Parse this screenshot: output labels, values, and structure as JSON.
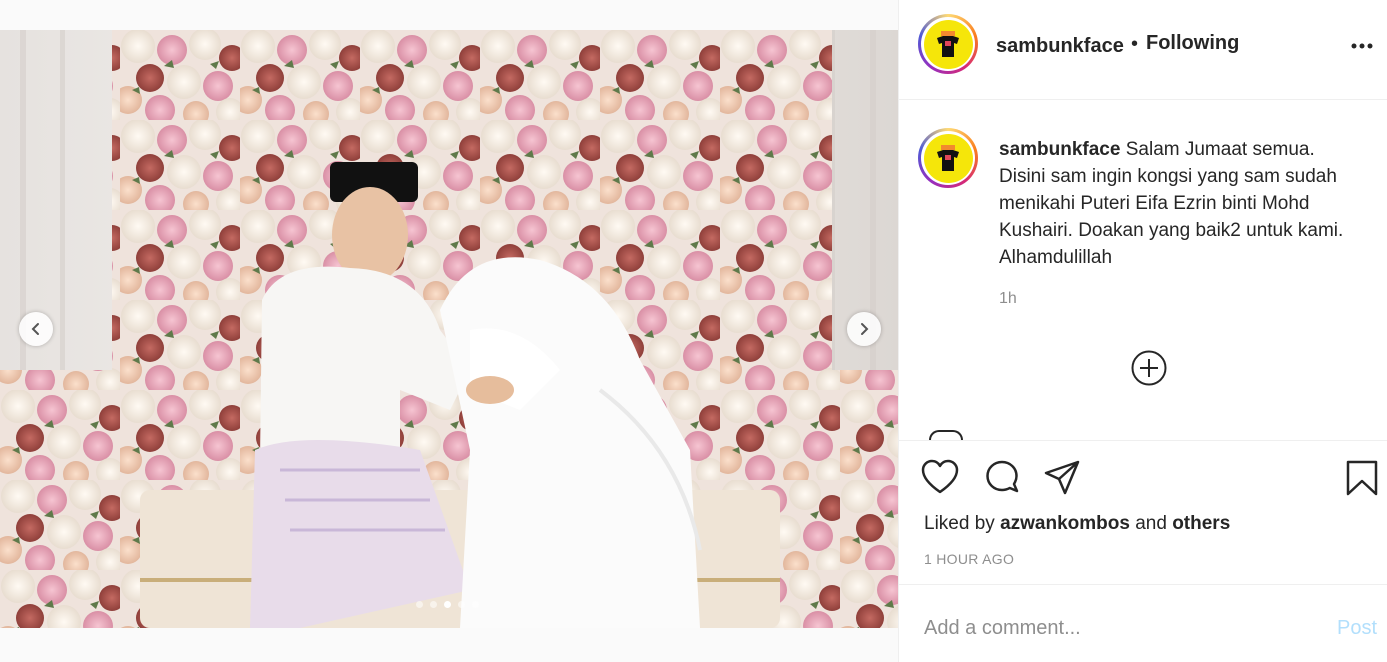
{
  "post": {
    "username": "sambunkface",
    "separator": "•",
    "follow_status": "Following",
    "more_icon": "more-horizontal-icon"
  },
  "caption": {
    "username": "sambunkface",
    "text": "Salam Jumaat semua. Disini sam ingin kongsi yang sam sudah menikahi Puteri Eifa Ezrin binti Mohd Kushairi. Doakan yang baik2 untuk kami. Alhamdulillah",
    "time_ago": "1h"
  },
  "likes": {
    "prefix": "Liked by",
    "user": "azwankombos",
    "connector": "and",
    "others": "others"
  },
  "timestamp": "1 HOUR AGO",
  "comment": {
    "placeholder": "Add a comment...",
    "post_label": "Post"
  },
  "carousel": {
    "slide_count": 5,
    "active_index": 2
  },
  "colors": {
    "avatar_bg": "#f5e60a",
    "post_disabled": "#b2dffc",
    "secondary_text": "#8e8e8e"
  }
}
